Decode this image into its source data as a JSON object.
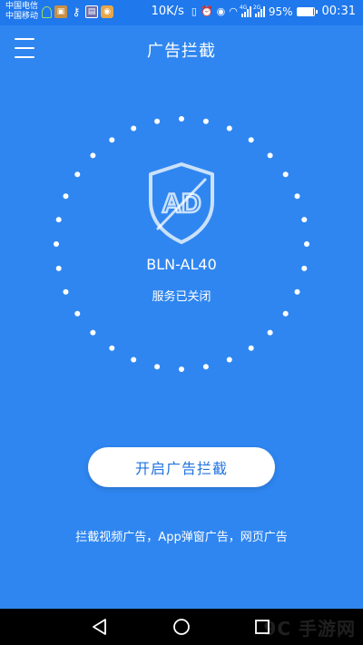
{
  "status_bar": {
    "carrier1": "中国电信",
    "carrier2": "中国移动",
    "net_speed": "10K/s",
    "sig_tag1": "4G",
    "sig_tag2": "2G",
    "battery_label": "95%",
    "battery_level": 0.95,
    "time": "00:31"
  },
  "app_bar": {
    "title": "广告拦截"
  },
  "main": {
    "device_name": "BLN-AL40",
    "service_status": "服务已关闭",
    "enable_button": "开启广告拦截",
    "description": "拦截视频广告，App弹窗广告，网页广告"
  },
  "watermark": "9C 手游网",
  "colors": {
    "background": "#2f86f0",
    "status_bar": "#1f78ec",
    "button_text": "#1f72e0"
  },
  "icons": {
    "shield": "ad-block-shield-icon",
    "menu": "menu-icon"
  }
}
